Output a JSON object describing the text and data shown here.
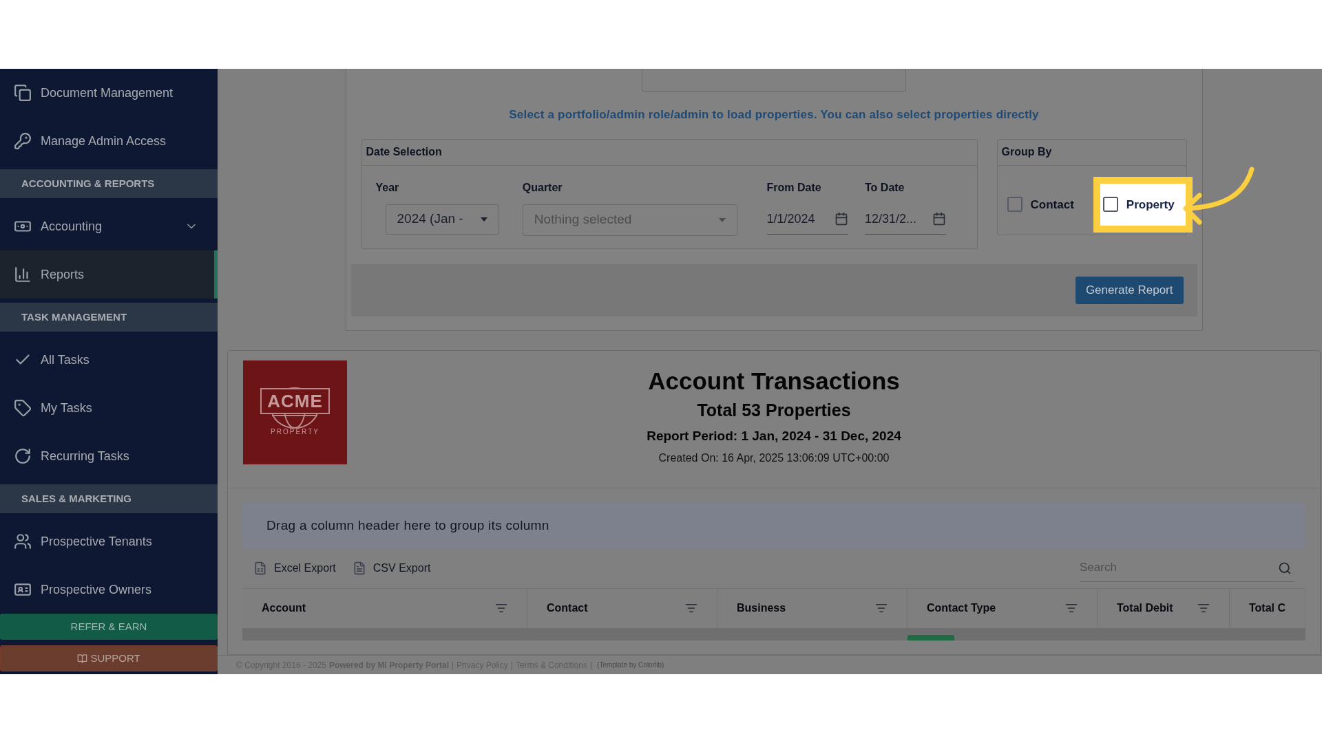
{
  "sidebar": {
    "items": [
      {
        "kind": "item",
        "label": "Document Management",
        "selected": false
      },
      {
        "kind": "item",
        "label": "Manage Admin Access",
        "selected": false
      },
      {
        "kind": "section",
        "label": "ACCOUNTING & REPORTS"
      },
      {
        "kind": "group",
        "label": "Accounting",
        "selected": false,
        "expanded": false
      },
      {
        "kind": "item",
        "label": "Reports",
        "selected": true
      },
      {
        "kind": "section",
        "label": "TASK MANAGEMENT"
      },
      {
        "kind": "item",
        "label": "All Tasks",
        "selected": false
      },
      {
        "kind": "item",
        "label": "My Tasks",
        "selected": false
      },
      {
        "kind": "item",
        "label": "Recurring Tasks",
        "selected": false
      },
      {
        "kind": "section",
        "label": "SALES & MARKETING"
      },
      {
        "kind": "item",
        "label": "Prospective Tenants",
        "selected": false
      },
      {
        "kind": "item",
        "label": "Prospective Owners",
        "selected": false
      }
    ],
    "buttons": [
      {
        "kind": "refer",
        "label": "REFER & EARN"
      },
      {
        "kind": "support",
        "label": "SUPPORT"
      }
    ]
  },
  "filters": {
    "hint": "Select a portfolio/admin role/admin to load properties. You can also select properties directly",
    "date_selection": {
      "title": "Date Selection",
      "year": {
        "label": "Year",
        "value": "2024 (Jan -"
      },
      "quarter": {
        "label": "Quarter",
        "placeholder": "Nothing selected"
      },
      "from_date": {
        "label": "From Date",
        "value": "1/1/2024"
      },
      "to_date": {
        "label": "To Date",
        "value": "12/31/2..."
      }
    },
    "group_by": {
      "title": "Group By",
      "options": [
        {
          "label": "Contact",
          "checked": false,
          "highlighted": false
        },
        {
          "label": "Property",
          "checked": false,
          "highlighted": true
        }
      ]
    },
    "generate_button": "Generate Report"
  },
  "report": {
    "logo": {
      "name": "ACME",
      "tagline": "PROPERTY"
    },
    "title": "Account Transactions",
    "subtitle": "Total 53 Properties",
    "period": "Report Period: 1 Jan, 2024 - 31 Dec, 2024",
    "created": "Created On: 16 Apr, 2025 13:06:09 UTC+00:00",
    "grid": {
      "group_hint": "Drag a column header here to group its column",
      "exports": [
        {
          "kind": "excel",
          "label": "Excel Export"
        },
        {
          "kind": "csv",
          "label": "CSV Export"
        }
      ],
      "search": {
        "placeholder": "Search"
      },
      "columns": [
        "Account",
        "Contact",
        "Business",
        "Contact Type",
        "Total Debit",
        "Total C"
      ]
    }
  },
  "footer": [
    {
      "kind": "text",
      "text": "© Copyright 2016 - 2025"
    },
    {
      "kind": "bold",
      "text": "Powered by MI Property Portal"
    },
    {
      "kind": "separator",
      "text": "|"
    },
    {
      "kind": "link",
      "text": "Privacy Policy"
    },
    {
      "kind": "separator",
      "text": "|"
    },
    {
      "kind": "link",
      "text": "Terms & Conditions"
    },
    {
      "kind": "separator",
      "text": "|"
    },
    {
      "kind": "note",
      "text": "(Template by Colorlib)"
    }
  ]
}
